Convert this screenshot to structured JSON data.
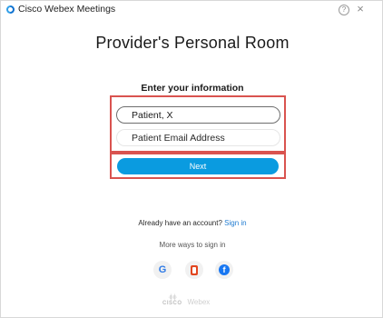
{
  "window": {
    "app_title": "Cisco Webex Meetings",
    "help_glyph": "?",
    "close_glyph": "×"
  },
  "main": {
    "room_title": "Provider's Personal Room",
    "section_title": "Enter your information",
    "name_field": {
      "value": "Patient, X",
      "placeholder": ""
    },
    "email_field": {
      "value": "",
      "placeholder": "Patient Email Address"
    },
    "next_label": "Next"
  },
  "signin": {
    "prompt": "Already have an account?",
    "link": "Sign in",
    "more_ways": "More ways to sign in",
    "providers": [
      {
        "name": "google",
        "glyph": "G",
        "icon": "google-icon"
      },
      {
        "name": "office",
        "glyph": "",
        "icon": "office-icon"
      },
      {
        "name": "facebook",
        "glyph": "f",
        "icon": "facebook-icon"
      }
    ]
  },
  "footer": {
    "cisco_bars": "·ı|ı·ı|ı·",
    "cisco_word": "CISCO",
    "webex_word": "Webex"
  },
  "colors": {
    "accent": "#0a9be0",
    "highlight_box": "#d9534f",
    "link": "#1f7bd1"
  }
}
